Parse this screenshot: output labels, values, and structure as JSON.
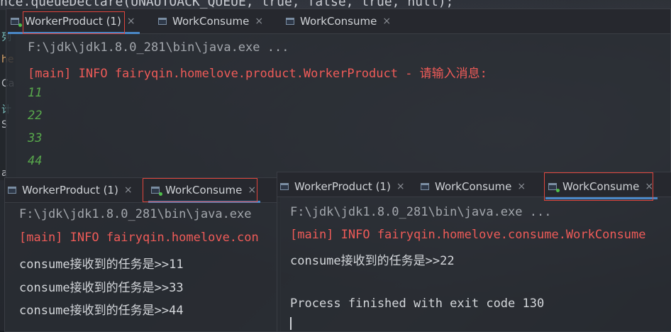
{
  "background": {
    "code_line": "nce.queueDeclare(UNAUTOACK_QUEUE, true, false, true, null);"
  },
  "panel_top": {
    "tabs": [
      {
        "label": "WorkerProduct (1)",
        "close": "×"
      },
      {
        "label": "WorkConsume",
        "close": "×"
      },
      {
        "label": "WorkConsume",
        "close": "×"
      }
    ],
    "lines": {
      "cmd": "F:\\jdk\\jdk1.8.0_281\\bin\\java.exe ...",
      "info": "[main] INFO fairyqin.homelove.product.WorkerProduct - 请输入消息:",
      "inputs": [
        "11",
        "22",
        "33",
        "44"
      ]
    }
  },
  "panel_bottom_left": {
    "tabs": [
      {
        "label": "WorkerProduct (1)",
        "close": "×"
      },
      {
        "label": "WorkConsume",
        "close": "×"
      }
    ],
    "lines": {
      "cmd": "F:\\jdk\\jdk1.8.0_281\\bin\\java.exe",
      "info": "[main] INFO fairyqin.homelove.con",
      "received": [
        "consume接收到的任务是>>11",
        "consume接收到的任务是>>33",
        "consume接收到的任务是>>44"
      ]
    }
  },
  "panel_bottom_right": {
    "tabs": [
      {
        "label": "WorkerProduct (1)",
        "close": "×"
      },
      {
        "label": "WorkConsume",
        "close": "×"
      },
      {
        "label": "WorkConsume",
        "close": "×"
      }
    ],
    "lines": {
      "cmd": "F:\\jdk\\jdk1.8.0_281\\bin\\java.exe ...",
      "info": "[main] INFO fairyqin.homelove.consume.WorkConsume",
      "received": "consume接收到的任务是>>22",
      "exit": "Process finished with exit code 130"
    }
  },
  "colors": {
    "highlight_border": "#e0453d",
    "tab_underline": "#4a88c7",
    "log_red": "#ef5b58",
    "input_green": "#58a84c"
  }
}
